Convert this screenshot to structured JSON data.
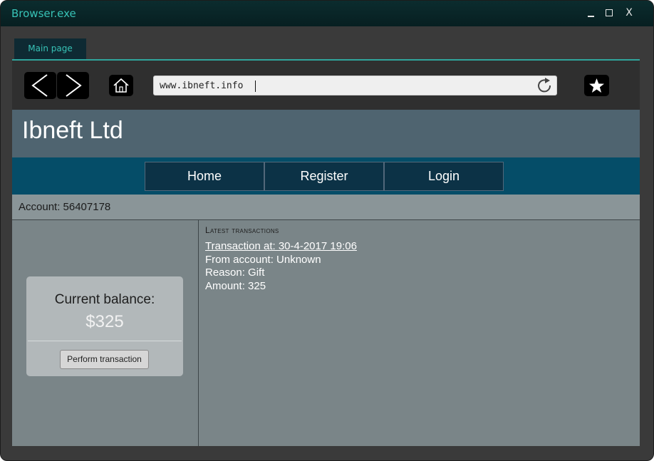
{
  "window": {
    "title": "Browser.exe",
    "controls": {
      "minimize_icon": "minimize-icon",
      "maximize_icon": "maximize-icon",
      "close_label": "X"
    }
  },
  "tabs": [
    {
      "label": "Main page",
      "active": true
    }
  ],
  "toolbar": {
    "url": "www.ibneft.info",
    "icons": [
      "back-arrow-icon",
      "forward-arrow-icon",
      "home-icon",
      "reload-icon",
      "star-icon"
    ]
  },
  "site": {
    "title": "Ibneft Ltd",
    "nav": {
      "home": "Home",
      "register": "Register",
      "login": "Login"
    },
    "account_label": "Account: 56407178",
    "balance": {
      "label": "Current balance:",
      "value": "$325",
      "action_label": "Perform transaction"
    },
    "transactions": {
      "heading": "Latest transactions",
      "items": [
        {
          "title": "Transaction at: 30-4-2017 19:06",
          "from": "From account: Unknown",
          "reason": "Reason: Gift",
          "amount": "Amount: 325"
        }
      ]
    }
  },
  "colors": {
    "accent": "#37c2b6",
    "header_bg": "#4f6470",
    "nav_bg": "#054d68",
    "page_bg": "#7a8588"
  }
}
